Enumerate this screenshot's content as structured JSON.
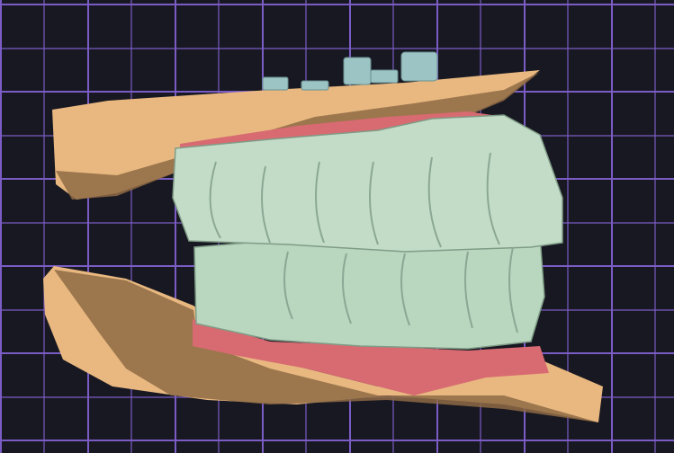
{
  "viewport": {
    "background_color": "#181822",
    "grid_color": "#7a5cc4",
    "model_colors": {
      "stone_base": "#e8b880",
      "stone_shadow": "#8a6640",
      "gingiva": "#d86a72",
      "teeth": "#b9d6bf",
      "implant_abutments": "#9cc4c4"
    }
  }
}
